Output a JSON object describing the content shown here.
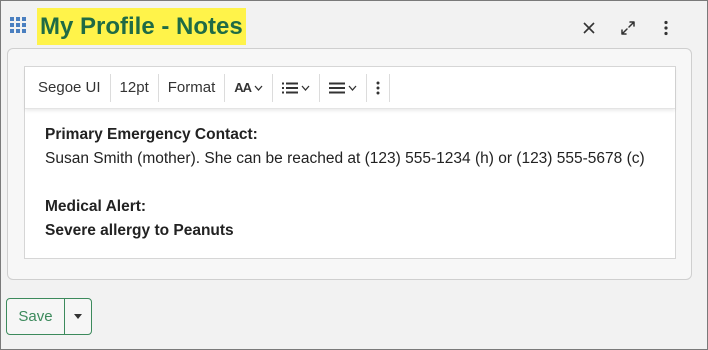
{
  "header": {
    "title": "My Profile - Notes",
    "icons": [
      "grid-icon",
      "close-icon",
      "expand-icon",
      "more-vertical-icon"
    ],
    "accent_color": "#1f6b45",
    "highlight_color": "#fff34a"
  },
  "toolbar": {
    "font_family": "Segoe UI",
    "font_size": "12pt",
    "format_label": "Format",
    "text_size_label": "AA",
    "icons": [
      "text-size-icon",
      "list-icon",
      "align-icon",
      "more-vertical-icon"
    ]
  },
  "content": {
    "heading1": "Primary Emergency Contact:",
    "line1": "Susan Smith (mother). She can be reached at (123) 555-1234 (h) or (123) 555-5678 (c)",
    "heading2": "Medical Alert:",
    "line2": "Severe allergy to Peanuts"
  },
  "footer": {
    "save_label": "Save",
    "button_color": "#3c8a5c"
  }
}
